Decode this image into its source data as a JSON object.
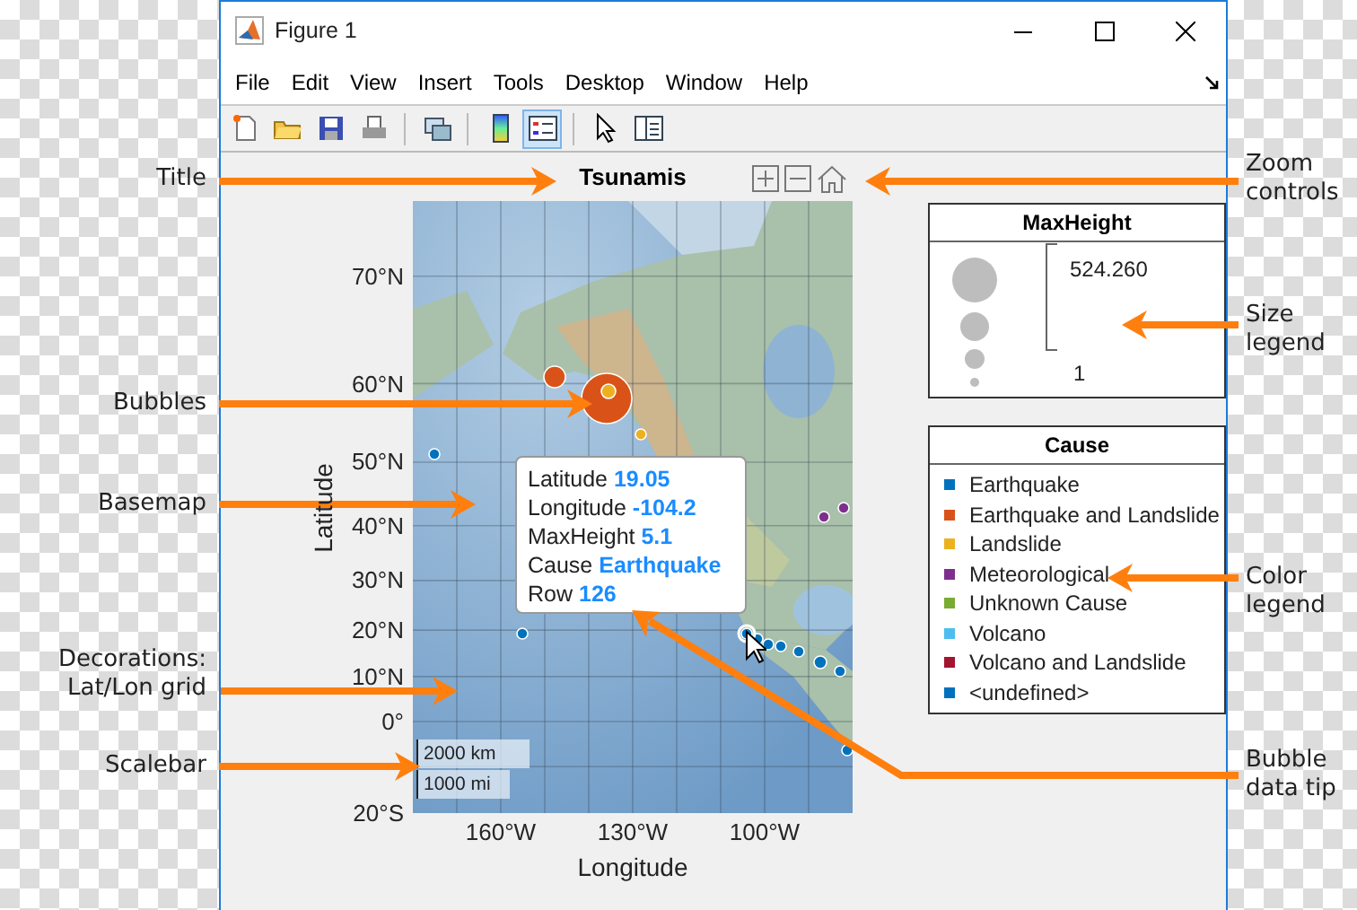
{
  "window": {
    "title": "Figure 1"
  },
  "menu": [
    "File",
    "Edit",
    "View",
    "Insert",
    "Tools",
    "Desktop",
    "Window",
    "Help"
  ],
  "toolbar": [
    {
      "kind": "new",
      "selected": false
    },
    {
      "kind": "open",
      "selected": false
    },
    {
      "kind": "save",
      "selected": false
    },
    {
      "kind": "print",
      "selected": false
    },
    {
      "kind": "link",
      "selected": false
    },
    {
      "kind": "colorbar",
      "selected": false
    },
    {
      "kind": "legend",
      "selected": true
    },
    {
      "kind": "pointer",
      "selected": false
    },
    {
      "kind": "inspector",
      "selected": false
    }
  ],
  "axes": {
    "title": "Tsunamis",
    "ylabel": "Latitude",
    "xlabel": "Longitude",
    "lat_ticks": [
      "70°N",
      "60°N",
      "50°N",
      "40°N",
      "30°N",
      "20°N",
      "10°N",
      "0°",
      "20°S"
    ],
    "lon_ticks": [
      "160°W",
      "130°W",
      "100°W"
    ],
    "scalebar": [
      "2000 km",
      "1000 mi"
    ],
    "datatip": [
      {
        "label": "Latitude",
        "value": "19.05"
      },
      {
        "label": "Longitude",
        "value": "-104.2"
      },
      {
        "label": "MaxHeight",
        "value": "5.1"
      },
      {
        "label": "Cause",
        "value": "Earthquake"
      },
      {
        "label": "Row",
        "value": "126"
      }
    ]
  },
  "size_legend": {
    "title": "MaxHeight",
    "max": "524.260",
    "min": "1"
  },
  "color_legend": {
    "title": "Cause",
    "items": [
      {
        "label": "Earthquake",
        "color": "#0072bd"
      },
      {
        "label": "Earthquake and Landslide",
        "color": "#d95319"
      },
      {
        "label": "Landslide",
        "color": "#edb120"
      },
      {
        "label": "Meteorological",
        "color": "#7e2f8e"
      },
      {
        "label": "Unknown Cause",
        "color": "#77ac30"
      },
      {
        "label": "Volcano",
        "color": "#4dbeee"
      },
      {
        "label": "Volcano and Landslide",
        "color": "#a2142f"
      },
      {
        "label": "<undefined>",
        "color": "#0072bd"
      }
    ]
  },
  "left_annotations": [
    "Title",
    "Bubbles",
    "Basemap",
    "Decorations: Lat/Lon grid",
    "Scalebar"
  ],
  "right_annotations": [
    "Zoom controls",
    "Size legend",
    "Color legend",
    "Bubble data tip"
  ]
}
